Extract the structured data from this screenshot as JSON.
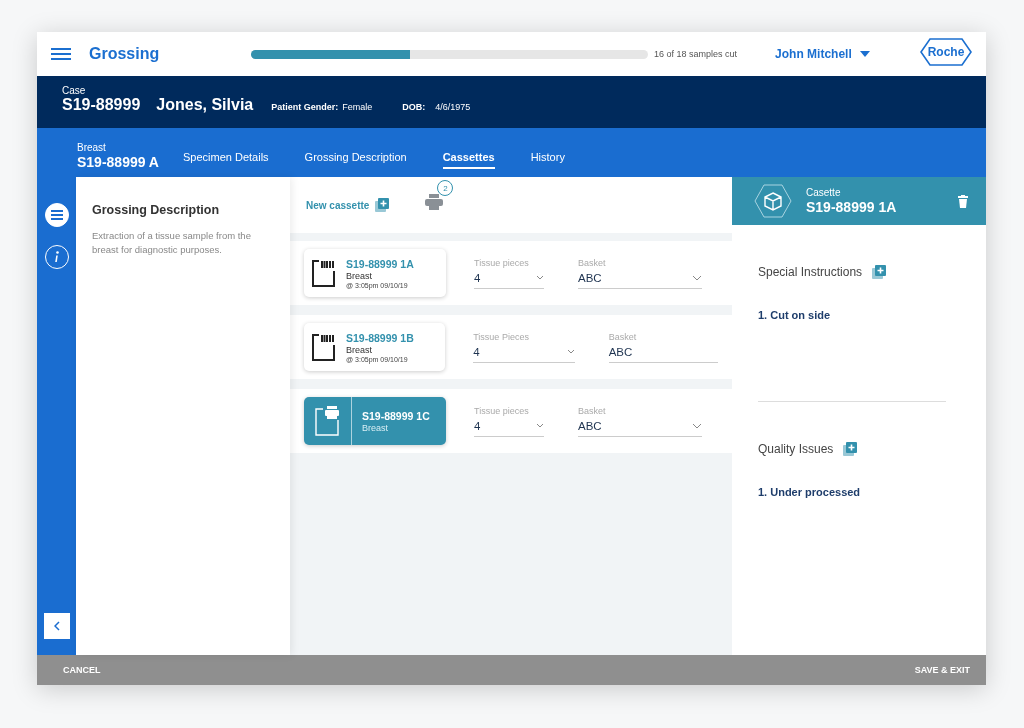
{
  "app_bar": {
    "title": "Grossing",
    "progress": {
      "level": 0.4,
      "label": "16 of 18 samples cut"
    },
    "user": "John Mitchell",
    "logo": "Roche"
  },
  "case": {
    "label": "Case",
    "id": "S19-88999",
    "patient": "Jones, Silvia",
    "gender_label": "Patient Gender:",
    "gender": "Female",
    "dob_label": "DOB:",
    "dob": "4/6/1975"
  },
  "specimen": {
    "label": "Breast",
    "id": "S19-88999 A",
    "tabs": [
      {
        "label": "Specimen Details",
        "selected": false
      },
      {
        "label": "Grossing Description",
        "selected": false
      },
      {
        "label": "Cassettes",
        "selected": true
      },
      {
        "label": "History",
        "selected": false
      }
    ]
  },
  "rail": {
    "items": [
      {
        "kind": "list",
        "selected": true
      },
      {
        "kind": "info",
        "selected": false
      }
    ]
  },
  "description": {
    "title": "Grossing Description",
    "text": "Extraction of a tissue sample from the breast for diagnostic purposes."
  },
  "toolbar": {
    "new_label": "New cassette",
    "print_count": "2"
  },
  "cassettes": [
    {
      "id": "S19-88999 1A",
      "organ": "Breast",
      "time": "@ 3:05pm 09/10/19",
      "selected": false,
      "pieces_label": "Tissue pieces",
      "pieces": "4",
      "basket_label": "Basket",
      "basket": "ABC"
    },
    {
      "id": "S19-88999 1B",
      "organ": "Breast",
      "time": "@ 3:05pm 09/10/19",
      "selected": false,
      "pieces_label": "Tissue Pieces",
      "pieces": "4",
      "basket_label": "Basket",
      "basket": "ABC"
    },
    {
      "id": "S19-88999 1C",
      "organ": "Breast",
      "selected": true,
      "pieces_label": "Tissue pieces",
      "pieces": "4",
      "basket_label": "Basket",
      "basket": "ABC"
    }
  ],
  "detail": {
    "label": "Casette",
    "id": "S19-88999 1A",
    "sections": [
      {
        "title": "Special Instructions",
        "items": [
          "1. Cut on side"
        ]
      },
      {
        "title": "Quality Issues",
        "items": [
          "1. Under processed"
        ]
      }
    ]
  },
  "footer": {
    "cancel": "CANCEL",
    "save": "SAVE & EXIT"
  }
}
